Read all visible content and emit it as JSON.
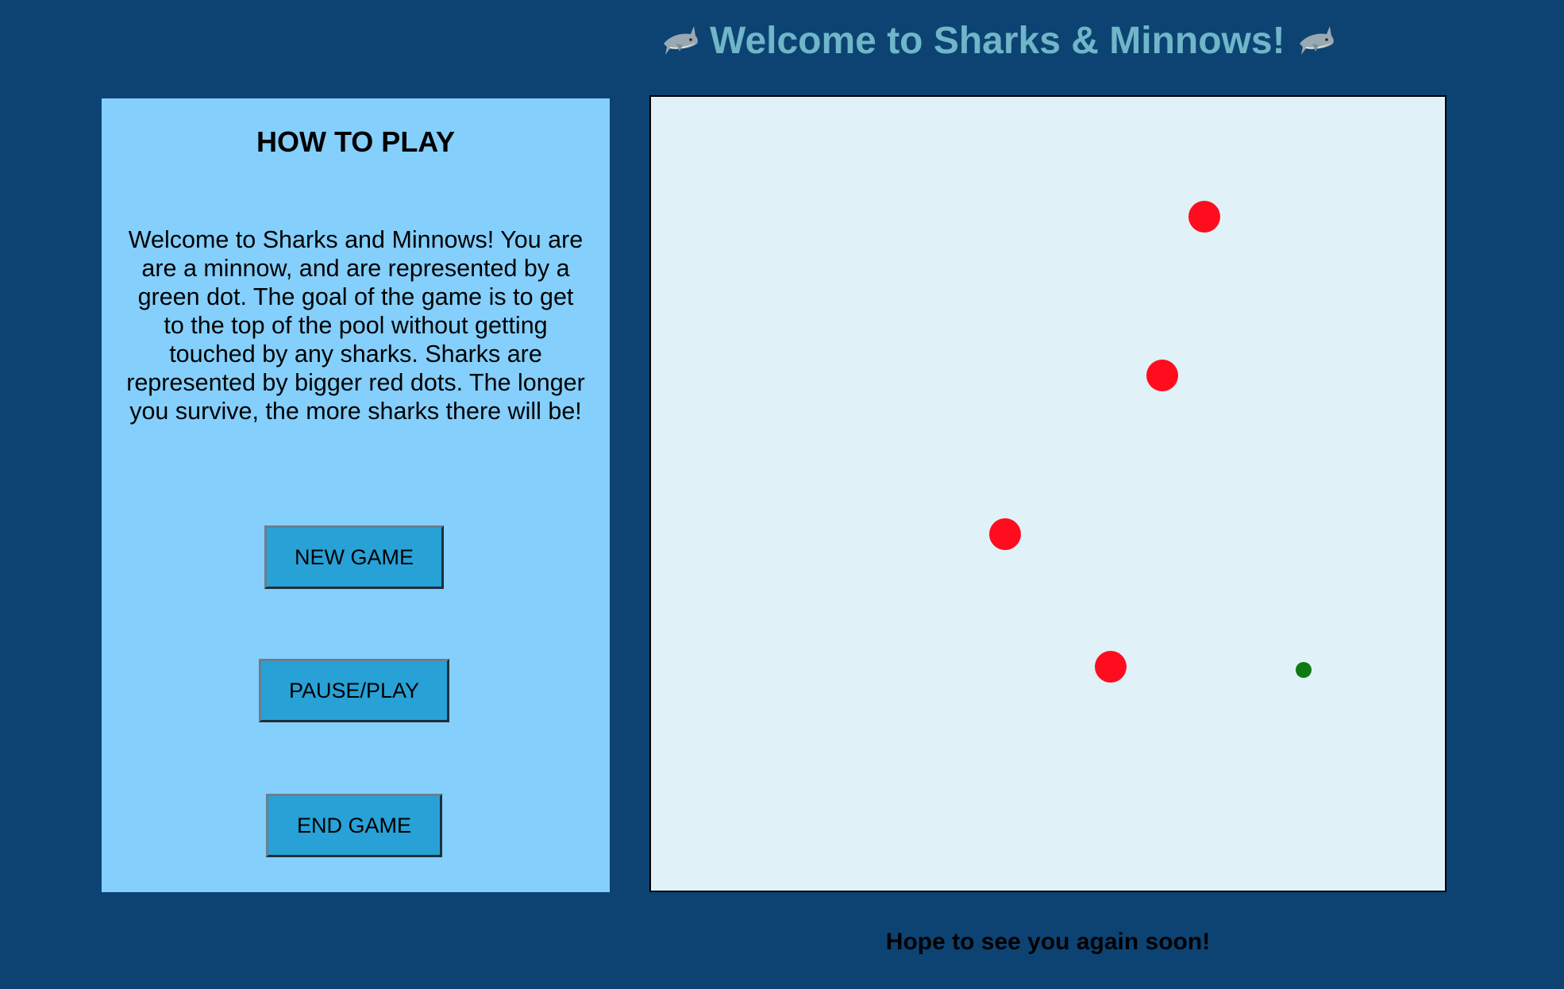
{
  "header": {
    "title": "Welcome to Sharks & Minnows!",
    "icon_left": "shark-icon",
    "icon_right": "shark-icon"
  },
  "instructions": {
    "heading": "HOW TO PLAY",
    "body": "Welcome to Sharks and Minnows! You are are a minnow, and are represented by a green dot. The goal of the game is to get to the top of the pool without getting touched by any sharks. Sharks are represented by bigger red dots. The longer you survive, the more sharks there will be!"
  },
  "controls": {
    "new_game_label": "NEW GAME",
    "pause_play_label": "PAUSE/PLAY",
    "end_game_label": "END GAME"
  },
  "board": {
    "shark_color": "#ff0d1e",
    "minnow_color": "#0e7a16",
    "sharks": [
      {
        "name": "shark-1"
      },
      {
        "name": "shark-2"
      },
      {
        "name": "shark-3"
      },
      {
        "name": "shark-4"
      }
    ],
    "minnow": {
      "name": "minnow"
    }
  },
  "footer": {
    "message": "Hope to see you again soon!"
  },
  "colors": {
    "page_background": "#0d4373",
    "title_color": "#6fb6c8",
    "panel_background": "#84cffc",
    "button_background": "#28a1d6",
    "board_background": "#e0f2f7"
  }
}
